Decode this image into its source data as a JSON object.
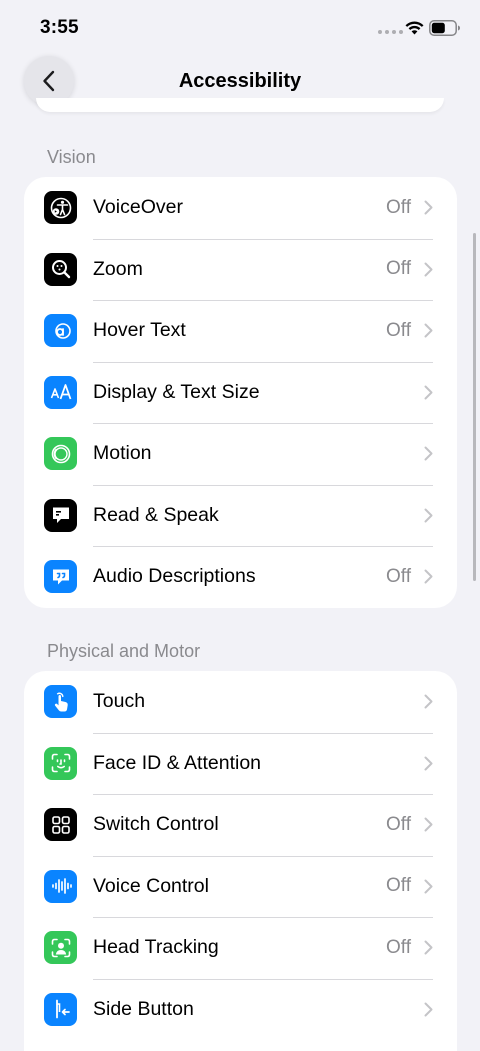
{
  "status_bar": {
    "time": "3:55"
  },
  "nav": {
    "title": "Accessibility"
  },
  "colors": {
    "black_icon": "#000000",
    "blue_icon": "#0A84FF",
    "green_icon": "#34C759",
    "secondary_text": "#8A8A8E"
  },
  "sections": [
    {
      "header": "Vision",
      "items": [
        {
          "label": "VoiceOver",
          "value": "Off",
          "icon": "voiceover-icon"
        },
        {
          "label": "Zoom",
          "value": "Off",
          "icon": "zoom-icon"
        },
        {
          "label": "Hover Text",
          "value": "Off",
          "icon": "hover-text-icon"
        },
        {
          "label": "Display & Text Size",
          "value": "",
          "icon": "text-size-icon"
        },
        {
          "label": "Motion",
          "value": "",
          "icon": "motion-icon"
        },
        {
          "label": "Read & Speak",
          "value": "",
          "icon": "speech-bubble-icon"
        },
        {
          "label": "Audio Descriptions",
          "value": "Off",
          "icon": "audio-descriptions-icon"
        }
      ]
    },
    {
      "header": "Physical and Motor",
      "items": [
        {
          "label": "Touch",
          "value": "",
          "icon": "touch-hand-icon"
        },
        {
          "label": "Face ID & Attention",
          "value": "",
          "icon": "face-id-icon"
        },
        {
          "label": "Switch Control",
          "value": "Off",
          "icon": "switch-grid-icon"
        },
        {
          "label": "Voice Control",
          "value": "Off",
          "icon": "waveform-icon"
        },
        {
          "label": "Head Tracking",
          "value": "Off",
          "icon": "head-tracking-icon"
        },
        {
          "label": "Side Button",
          "value": "",
          "icon": "side-button-icon"
        }
      ]
    }
  ]
}
